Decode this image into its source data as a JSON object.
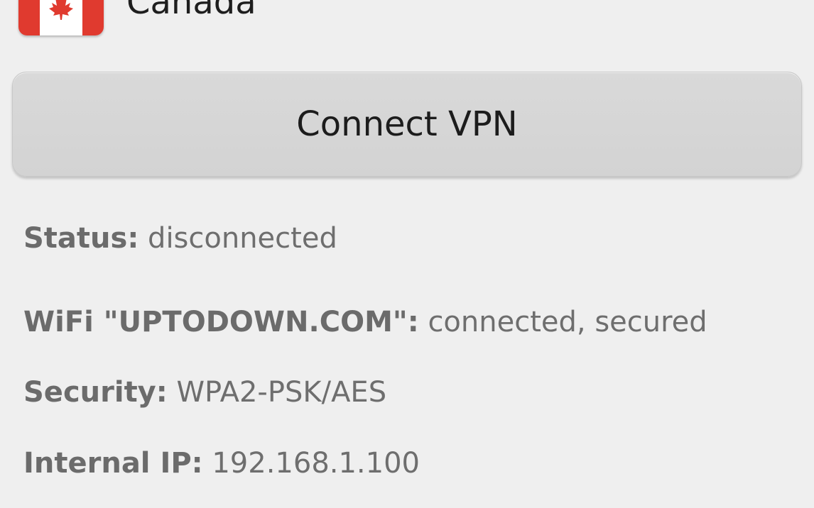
{
  "server": {
    "country": "Canada",
    "flag_icon": "canada-flag-icon",
    "flag_colors": {
      "red": "#e03a2f",
      "white": "#ffffff"
    }
  },
  "connect_button": {
    "label": "Connect VPN"
  },
  "info": {
    "status": {
      "label": "Status:",
      "value": "disconnected"
    },
    "wifi": {
      "label": "WiFi \"UPTODOWN.COM\":",
      "value": "connected, secured"
    },
    "security": {
      "label": "Security:",
      "value": "WPA2-PSK/AES"
    },
    "internal_ip": {
      "label": "Internal IP:",
      "value": "192.168.1.100"
    }
  },
  "colors": {
    "background": "#efefef",
    "button_background": "#d6d6d6",
    "text_dark": "#1c1c1c",
    "text_gray": "#6b6b6b"
  }
}
